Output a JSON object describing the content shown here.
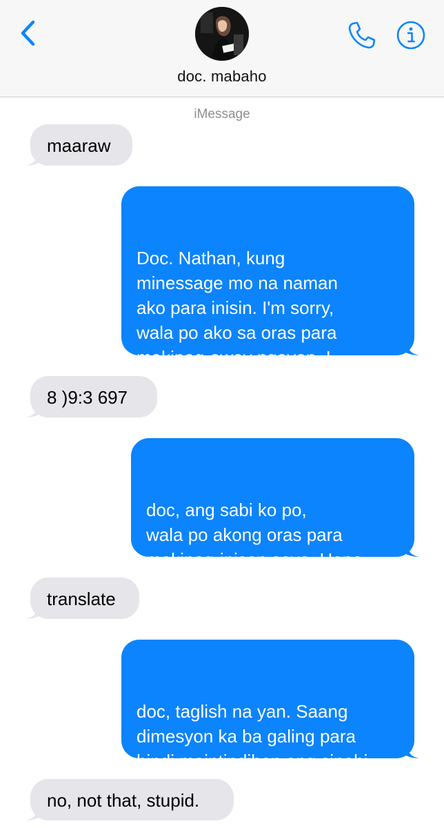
{
  "colors": {
    "accent": "#0b84fe",
    "incoming_bubble": "#e5e5ea",
    "outgoing_bubble": "#0b84fe",
    "header_background": "#f7f7f7",
    "service_label": "#8e8e93"
  },
  "header": {
    "back_icon": "chevron-left-icon",
    "contact_name": "doc. mabaho",
    "phone_icon": "phone-icon",
    "info_icon": "info-icon"
  },
  "thread": {
    "service_label": "iMessage",
    "messages": [
      {
        "direction": "incoming",
        "text": "maaraw"
      },
      {
        "direction": "outgoing",
        "text": "Doc. Nathan, kung\nminessage mo na naman\nako para inisin. I'm sorry,\nwala po ako sa oras para\nmakipag-away ngayon. I\nhave more patients to check."
      },
      {
        "direction": "incoming",
        "text": "8 )9:3 697"
      },
      {
        "direction": "outgoing",
        "text": "doc, ang sabi ko po,\nwala po akong  oras para\nmakipag-inisan sayo. Hope\nyou understand. Thank you."
      },
      {
        "direction": "incoming",
        "text": "translate"
      },
      {
        "direction": "outgoing",
        "text": "doc, taglish na yan. Saang\ndimesyon ka ba galing para\nhindi maintindihan ang sinabi\nko?"
      },
      {
        "direction": "incoming",
        "text": "no, not that, stupid."
      }
    ]
  }
}
